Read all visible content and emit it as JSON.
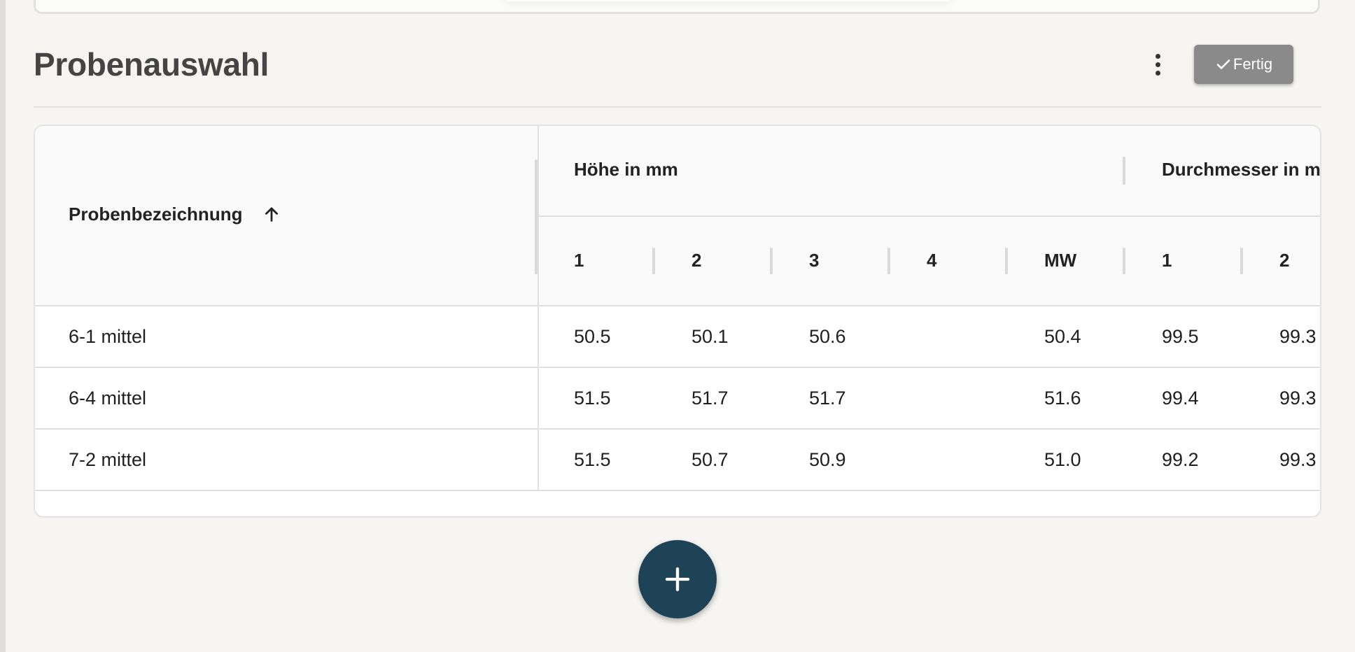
{
  "page": {
    "title": "Probenauswahl",
    "done_label": "Fertig"
  },
  "table": {
    "sample_header": "Probenbezeichnung",
    "group_height": "Höhe in mm",
    "group_diameter": "Durchmesser in m",
    "sub_headers": [
      "1",
      "2",
      "3",
      "4",
      "MW",
      "1",
      "2"
    ],
    "rows": [
      {
        "name": "6-1 mittel",
        "values": [
          "50.5",
          "50.1",
          "50.6",
          "",
          "50.4",
          "99.5",
          "99.3"
        ]
      },
      {
        "name": "6-4 mittel",
        "values": [
          "51.5",
          "51.7",
          "51.7",
          "",
          "51.6",
          "99.4",
          "99.3"
        ]
      },
      {
        "name": "7-2 mittel",
        "values": [
          "51.5",
          "50.7",
          "50.9",
          "",
          "51.0",
          "99.2",
          "99.3"
        ]
      }
    ]
  },
  "icons": {
    "more": "more-vert-icon",
    "check": "check-icon",
    "sort": "arrow-up-icon",
    "add": "plus-icon"
  },
  "colors": {
    "background": "#f6f5f2",
    "fab": "#1f4356",
    "done_button": "#8a8a8a",
    "title": "#444444"
  }
}
